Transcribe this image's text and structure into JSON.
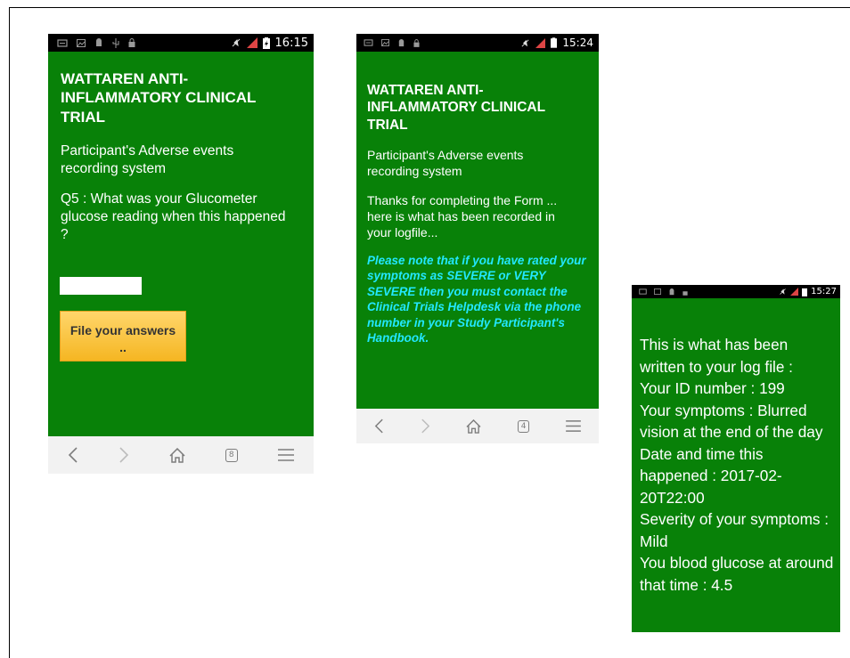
{
  "phone1": {
    "status": {
      "time": "16:15"
    },
    "title": "WATTAREN ANTI-INFLAMMATORY CLINICAL TRIAL",
    "subtitle": "Participant's Adverse events recording system",
    "question": "Q5 : What was your Glucometer glucose reading when this happened ?",
    "input_value": "",
    "file_button": "File your answers",
    "file_button_sub": "..",
    "tab_count": "8"
  },
  "phone2": {
    "status": {
      "time": "15:24"
    },
    "title": "WATTAREN ANTI-INFLAMMATORY CLINICAL TRIAL",
    "subtitle": "Participant's Adverse events recording system",
    "thanks": "Thanks for completing the Form ... here is what has been recorded in your logfile...",
    "note": "Please note that if you have rated your symptoms as SEVERE or VERY SEVERE then you must contact the Clinical Trials Helpdesk via the phone number in your Study Participant's Handbook.",
    "tab_count": "4"
  },
  "phone3": {
    "status": {
      "time": "15:27"
    },
    "lines": [
      "This is what has been written to your log file :",
      "Your ID number : 199",
      "Your symptoms : Blurred vision at the end of the day",
      "Date and time this happened : 2017-02-20T22:00",
      "Severity of your symptoms : Mild",
      "You blood glucose at around that time : 4.5"
    ]
  },
  "colors": {
    "screen_green": "#088108",
    "note_cyan": "#22e7ff",
    "button_gold": "#f5b622",
    "navbar_gray": "#f2f2f2"
  },
  "icons": [
    "back-icon",
    "forward-icon",
    "home-icon",
    "tabs-icon",
    "menu-icon",
    "mute-icon",
    "signal-icon",
    "battery-icon"
  ]
}
